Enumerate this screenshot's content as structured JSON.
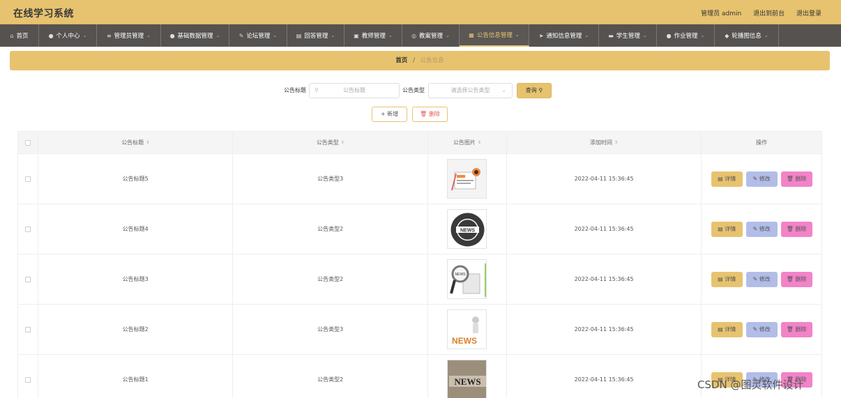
{
  "app": {
    "title": "在线学习系统"
  },
  "header": {
    "admin_label": "管理员 admin",
    "front_link": "退出到前台",
    "logout": "退出登录"
  },
  "nav": [
    {
      "label": "首页",
      "icon": "home-icon",
      "glyph": "⌂",
      "has_dropdown": false,
      "active": false
    },
    {
      "label": "个人中心",
      "icon": "user-icon",
      "glyph": "●",
      "has_dropdown": true,
      "active": false
    },
    {
      "label": "管理员管理",
      "icon": "list-icon",
      "glyph": "≡",
      "has_dropdown": true,
      "active": false
    },
    {
      "label": "基础数据管理",
      "icon": "person-icon",
      "glyph": "●",
      "has_dropdown": true,
      "active": false
    },
    {
      "label": "论坛管理",
      "icon": "forum-icon",
      "glyph": "✎",
      "has_dropdown": true,
      "active": false
    },
    {
      "label": "回答管理",
      "icon": "doc-icon",
      "glyph": "▤",
      "has_dropdown": true,
      "active": false
    },
    {
      "label": "教师管理",
      "icon": "teacher-icon",
      "glyph": "▣",
      "has_dropdown": true,
      "active": false
    },
    {
      "label": "教案管理",
      "icon": "compass-icon",
      "glyph": "◎",
      "has_dropdown": true,
      "active": false
    },
    {
      "label": "公告信息管理",
      "icon": "notice-icon",
      "glyph": "▦",
      "has_dropdown": true,
      "active": true
    },
    {
      "label": "通知信息管理",
      "icon": "send-icon",
      "glyph": "➤",
      "has_dropdown": true,
      "active": false
    },
    {
      "label": "学生管理",
      "icon": "student-icon",
      "glyph": "▬",
      "has_dropdown": true,
      "active": false
    },
    {
      "label": "作业管理",
      "icon": "homework-icon",
      "glyph": "●",
      "has_dropdown": true,
      "active": false
    },
    {
      "label": "轮播图信息",
      "icon": "image-icon",
      "glyph": "◆",
      "has_dropdown": true,
      "active": false
    }
  ],
  "breadcrumb": {
    "home": "首页",
    "separator": "/",
    "current": "公告信息"
  },
  "search": {
    "title_label": "公告标题",
    "title_placeholder": "公告标题",
    "type_label": "公告类型",
    "type_placeholder": "请选择公告类型",
    "query_button": "查询"
  },
  "actions": {
    "add": "新增",
    "delete": "删除"
  },
  "table": {
    "headers": [
      "公告标题",
      "公告类型",
      "公告图片",
      "添加时间",
      "操作"
    ],
    "rows": [
      {
        "title": "公告标题5",
        "type": "公告类型3",
        "image": "news-image",
        "time": "2022-04-11 15:36:45"
      },
      {
        "title": "公告标题4",
        "type": "公告类型2",
        "image": "news-globe-image",
        "time": "2022-04-11 15:36:45"
      },
      {
        "title": "公告标题3",
        "type": "公告类型2",
        "image": "magnifier-news-image",
        "time": "2022-04-11 15:36:45"
      },
      {
        "title": "公告标题2",
        "type": "公告类型3",
        "image": "news-figure-image",
        "time": "2022-04-11 15:36:45"
      },
      {
        "title": "公告标题1",
        "type": "公告类型2",
        "image": "news-blocks-image",
        "time": "2022-04-11 15:36:45"
      }
    ],
    "row_actions": {
      "detail": "详情",
      "edit": "修改",
      "delete": "删除"
    }
  },
  "watermark": "CSDN @图灵软件设计",
  "colors": {
    "accent": "#e7c36f",
    "nav_bg": "#555250",
    "edit": "#b2bde8",
    "delete": "#f283c8"
  }
}
